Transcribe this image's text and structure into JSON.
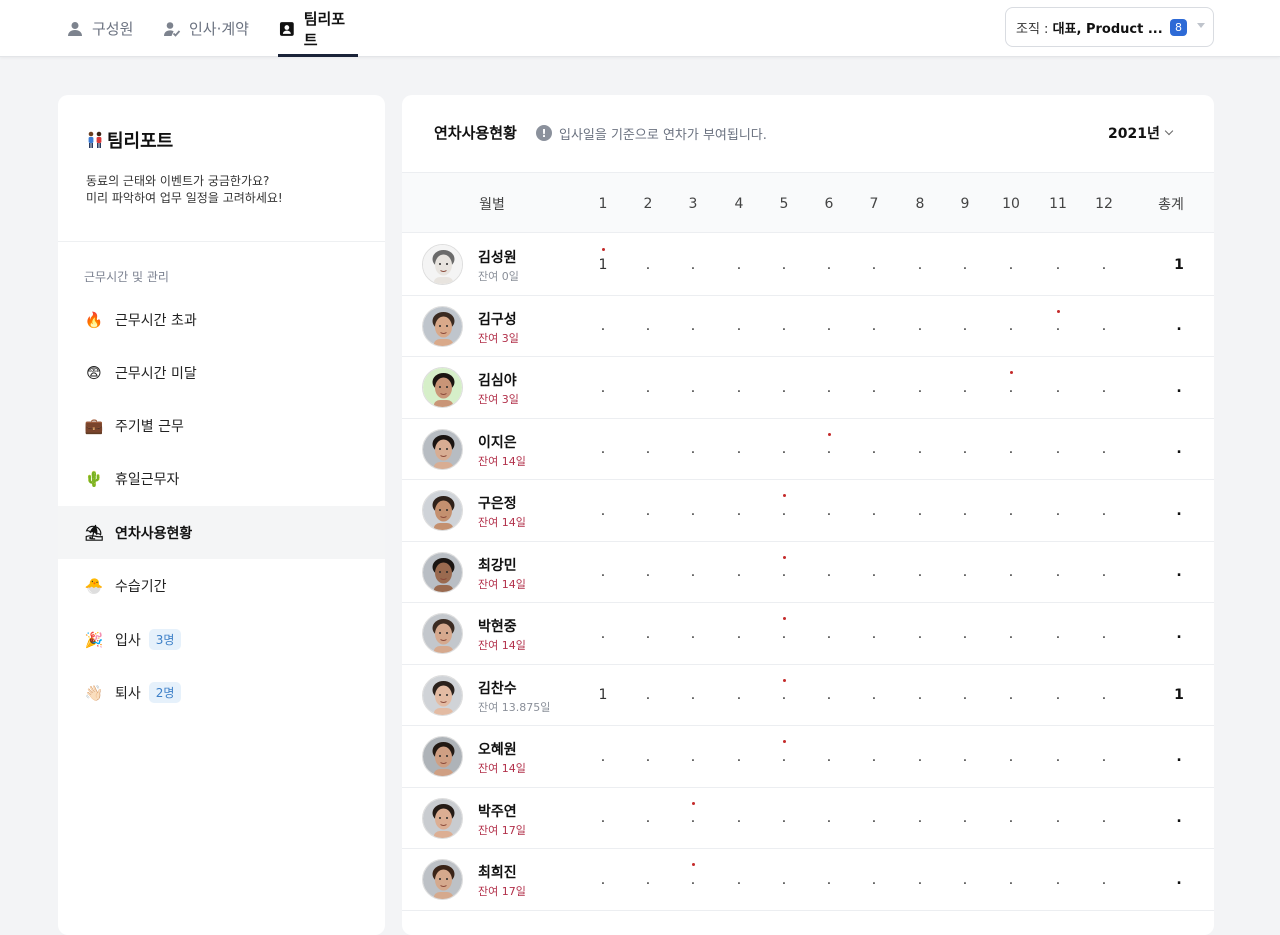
{
  "nav": {
    "tabs": [
      {
        "label": "구성원",
        "icon": "person-icon"
      },
      {
        "label": "인사·계약",
        "icon": "person-check-icon"
      },
      {
        "label": "팀리포트",
        "icon": "report-icon"
      }
    ],
    "active_tab": 2,
    "org_select": {
      "prefix": "조직 : ",
      "value": "대표, Product ...",
      "count": "8"
    }
  },
  "sidebar": {
    "title": "팀리포트",
    "description_line1": "동료의 근태와 이벤트가 궁금한가요?",
    "description_line2": "미리 파악하여 업무 일정을 고려하세요!",
    "section_label": "근무시간 및 관리",
    "items": [
      {
        "emoji": "🔥",
        "label": "근무시간 초과",
        "badge": ""
      },
      {
        "emoji": "😨",
        "label": "근무시간 미달",
        "badge": ""
      },
      {
        "emoji": "💼",
        "label": "주기별 근무",
        "badge": ""
      },
      {
        "emoji": "🌵",
        "label": "휴일근무자",
        "badge": ""
      },
      {
        "emoji": "⛱",
        "label": "연차사용현황",
        "badge": ""
      },
      {
        "emoji": "🐣",
        "label": "수습기간",
        "badge": ""
      },
      {
        "emoji": "🎉",
        "label": "입사",
        "badge": "3명"
      },
      {
        "emoji": "👋🏻",
        "label": "퇴사",
        "badge": "2명"
      }
    ],
    "active_item": 4
  },
  "main": {
    "title": "연차사용현황",
    "info_icon": "!",
    "info_text": "입사일을 기준으로 연차가 부여됩니다.",
    "year": "2021년",
    "columns": {
      "month_label": "월별",
      "months": [
        "1",
        "2",
        "3",
        "4",
        "5",
        "6",
        "7",
        "8",
        "9",
        "10",
        "11",
        "12"
      ],
      "total_label": "총계"
    },
    "rows": [
      {
        "name": "김성원",
        "remain": "잔여 0일",
        "remain_red": false,
        "values": [
          "1",
          ".",
          ".",
          ".",
          ".",
          ".",
          ".",
          ".",
          ".",
          ".",
          ".",
          "."
        ],
        "dot_month": 1,
        "total": "1",
        "avatar": {
          "skin": "#e8e4df",
          "hair": "#6b6b6b",
          "bg": "#f4f4f4"
        }
      },
      {
        "name": "김구성",
        "remain": "잔여 3일",
        "remain_red": true,
        "values": [
          ".",
          ".",
          ".",
          ".",
          ".",
          ".",
          ".",
          ".",
          ".",
          ".",
          ".",
          "."
        ],
        "dot_month": 11,
        "total": ".",
        "avatar": {
          "skin": "#d9a98a",
          "hair": "#3a2a20",
          "bg": "#bfc5cc"
        }
      },
      {
        "name": "김심야",
        "remain": "잔여 3일",
        "remain_red": true,
        "values": [
          ".",
          ".",
          ".",
          ".",
          ".",
          ".",
          ".",
          ".",
          ".",
          ".",
          ".",
          "."
        ],
        "dot_month": 10,
        "total": ".",
        "avatar": {
          "skin": "#c99577",
          "hair": "#1b1511",
          "bg": "#d6efc9"
        }
      },
      {
        "name": "이지은",
        "remain": "잔여 14일",
        "remain_red": true,
        "values": [
          ".",
          ".",
          ".",
          ".",
          ".",
          ".",
          ".",
          ".",
          ".",
          ".",
          ".",
          "."
        ],
        "dot_month": 6,
        "total": ".",
        "avatar": {
          "skin": "#d8ad93",
          "hair": "#1a1412",
          "bg": "#b7bcc2"
        }
      },
      {
        "name": "구은정",
        "remain": "잔여 14일",
        "remain_red": true,
        "values": [
          ".",
          ".",
          ".",
          ".",
          ".",
          ".",
          ".",
          ".",
          ".",
          ".",
          ".",
          "."
        ],
        "dot_month": 5,
        "total": ".",
        "avatar": {
          "skin": "#c4906f",
          "hair": "#2e211a",
          "bg": "#cfd3d8"
        }
      },
      {
        "name": "최강민",
        "remain": "잔여 14일",
        "remain_red": true,
        "values": [
          ".",
          ".",
          ".",
          ".",
          ".",
          ".",
          ".",
          ".",
          ".",
          ".",
          ".",
          "."
        ],
        "dot_month": 5,
        "total": ".",
        "avatar": {
          "skin": "#9a6a4f",
          "hair": "#1a1512",
          "bg": "#b9bec4"
        }
      },
      {
        "name": "박현중",
        "remain": "잔여 14일",
        "remain_red": true,
        "values": [
          ".",
          ".",
          ".",
          ".",
          ".",
          ".",
          ".",
          ".",
          ".",
          ".",
          ".",
          "."
        ],
        "dot_month": 5,
        "total": ".",
        "avatar": {
          "skin": "#d6a98e",
          "hair": "#3b2b22",
          "bg": "#c3c7cc"
        }
      },
      {
        "name": "김찬수",
        "remain": "잔여 13.875일",
        "remain_red": false,
        "values": [
          "1",
          ".",
          ".",
          ".",
          ".",
          ".",
          ".",
          ".",
          ".",
          ".",
          ".",
          "."
        ],
        "dot_month": 5,
        "total": "1",
        "avatar": {
          "skin": "#e3bba3",
          "hair": "#2a211c",
          "bg": "#d0d3d7"
        }
      },
      {
        "name": "오혜원",
        "remain": "잔여 14일",
        "remain_red": true,
        "values": [
          ".",
          ".",
          ".",
          ".",
          ".",
          ".",
          ".",
          ".",
          ".",
          ".",
          ".",
          "."
        ],
        "dot_month": 5,
        "total": ".",
        "avatar": {
          "skin": "#cf9f83",
          "hair": "#221913",
          "bg": "#aeb3b8"
        }
      },
      {
        "name": "박주연",
        "remain": "잔여 17일",
        "remain_red": true,
        "values": [
          ".",
          ".",
          ".",
          ".",
          ".",
          ".",
          ".",
          ".",
          ".",
          ".",
          ".",
          "."
        ],
        "dot_month": 3,
        "total": ".",
        "avatar": {
          "skin": "#dcae93",
          "hair": "#241b16",
          "bg": "#c9ccd0"
        }
      },
      {
        "name": "최희진",
        "remain": "잔여 17일",
        "remain_red": true,
        "values": [
          ".",
          ".",
          ".",
          ".",
          ".",
          ".",
          ".",
          ".",
          ".",
          ".",
          ".",
          "."
        ],
        "dot_month": 3,
        "total": ".",
        "avatar": {
          "skin": "#d5a98d",
          "hair": "#3a2418",
          "bg": "#bdc1c6"
        }
      }
    ]
  }
}
